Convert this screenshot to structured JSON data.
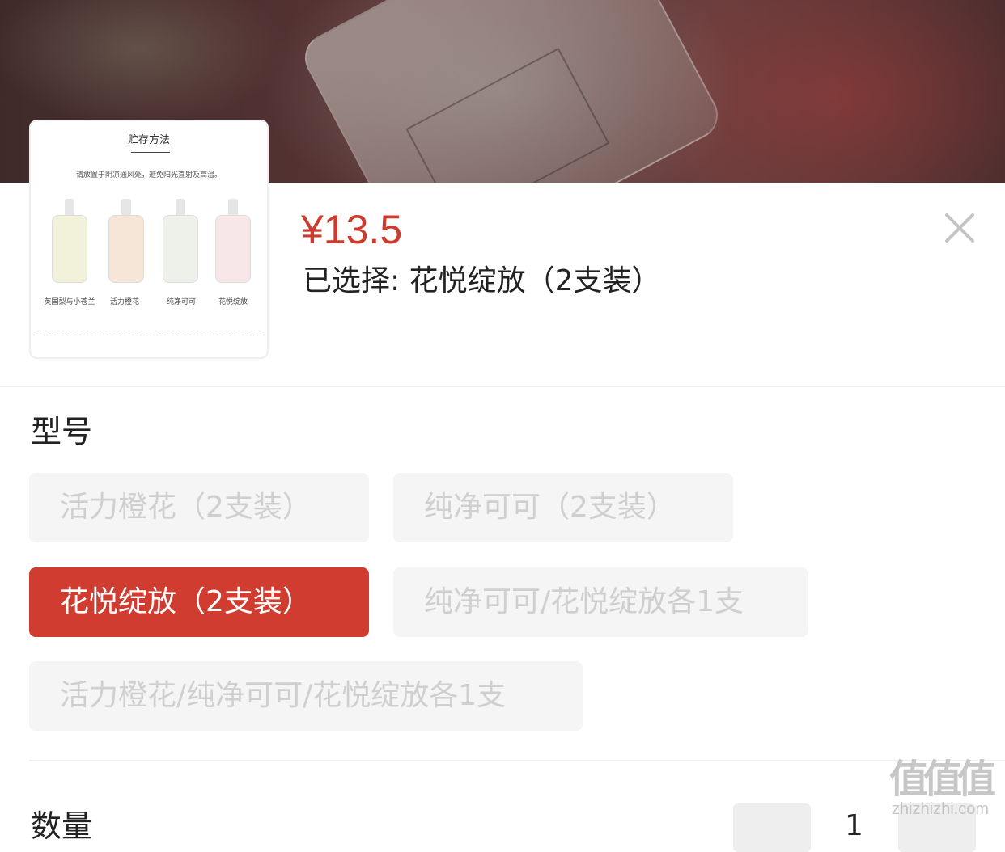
{
  "product": {
    "price": "¥13.5",
    "selected_text": "已选择: 花悦绽放（2支装）"
  },
  "thumbnail": {
    "title": "贮存方法",
    "note": "请放置于阴凉通风处，避免阳光直射及高温。",
    "captions": [
      "英国梨与小苍兰",
      "活力橙花",
      "纯净可可",
      "花悦绽放"
    ],
    "bottle_colors": [
      "#f1f2d9",
      "#f6e6d8",
      "#eef1ea",
      "#f7e7e9"
    ]
  },
  "spec": {
    "title": "型号",
    "options": [
      {
        "label": "活力橙花（2支装）",
        "selected": false
      },
      {
        "label": "纯净可可（2支装）",
        "selected": false
      },
      {
        "label": "花悦绽放（2支装）",
        "selected": true
      },
      {
        "label": "纯净可可/花悦绽放各1支",
        "selected": false
      },
      {
        "label": "活力橙花/纯净可可/花悦绽放各1支",
        "selected": false
      }
    ]
  },
  "quantity": {
    "label": "数量",
    "value": "1"
  },
  "watermark": {
    "big": "值值值",
    "small": "zhizhizhi.com"
  },
  "colors": {
    "accent": "#d03c2f",
    "price": "#cc3b2d",
    "chip_bg": "#f5f5f5",
    "chip_text_disabled": "#cfcfcf"
  },
  "icons": {
    "close": "close-icon"
  }
}
